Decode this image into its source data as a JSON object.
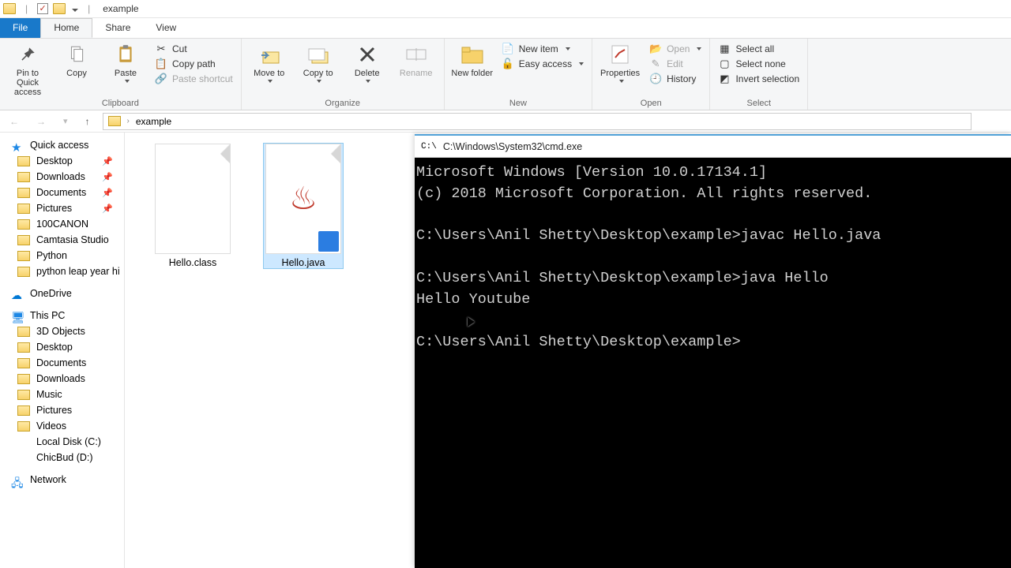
{
  "titlebar": {
    "title": "example"
  },
  "tabs": {
    "file": "File",
    "home": "Home",
    "share": "Share",
    "view": "View"
  },
  "ribbon": {
    "clipboard": {
      "label": "Clipboard",
      "pin": "Pin to Quick access",
      "copy": "Copy",
      "paste": "Paste",
      "cut": "Cut",
      "copypath": "Copy path",
      "pasteshort": "Paste shortcut"
    },
    "organize": {
      "label": "Organize",
      "moveto": "Move to",
      "copyto": "Copy to",
      "delete": "Delete",
      "rename": "Rename"
    },
    "new": {
      "label": "New",
      "newfolder": "New folder",
      "newitem": "New item",
      "easyaccess": "Easy access"
    },
    "open": {
      "label": "Open",
      "properties": "Properties",
      "open": "Open",
      "edit": "Edit",
      "history": "History"
    },
    "select": {
      "label": "Select",
      "all": "Select all",
      "none": "Select none",
      "invert": "Invert selection"
    }
  },
  "address": {
    "path": "example",
    "sep": "›"
  },
  "sidebar": {
    "quick": "Quick access",
    "items_pinned": [
      "Desktop",
      "Downloads",
      "Documents",
      "Pictures"
    ],
    "items_recent": [
      "100CANON",
      "Camtasia Studio",
      "Python",
      "python leap year hi"
    ],
    "onedrive": "OneDrive",
    "thispc": "This PC",
    "pc_items": [
      "3D Objects",
      "Desktop",
      "Documents",
      "Downloads",
      "Music",
      "Pictures",
      "Videos",
      "Local Disk (C:)",
      "ChicBud (D:)"
    ],
    "network": "Network"
  },
  "files": [
    {
      "name": "Hello.class",
      "selected": false,
      "type": "class"
    },
    {
      "name": "Hello.java",
      "selected": true,
      "type": "java"
    }
  ],
  "cmd": {
    "title": "C:\\Windows\\System32\\cmd.exe",
    "lines": [
      "Microsoft Windows [Version 10.0.17134.1]",
      "(c) 2018 Microsoft Corporation. All rights reserved.",
      "",
      "C:\\Users\\Anil Shetty\\Desktop\\example>javac Hello.java",
      "",
      "C:\\Users\\Anil Shetty\\Desktop\\example>java Hello",
      "Hello Youtube",
      "",
      "C:\\Users\\Anil Shetty\\Desktop\\example>"
    ]
  }
}
